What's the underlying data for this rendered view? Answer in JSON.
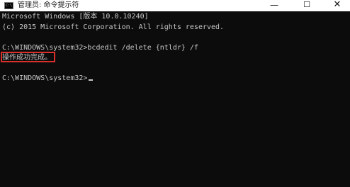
{
  "window": {
    "title": "管理员: 命令提示符",
    "icon": "cmd-icon",
    "icon_label": "C:\\",
    "controls": {
      "minimize": "—",
      "maximize": "☐",
      "close": "✕"
    }
  },
  "console": {
    "lines": [
      "Microsoft Windows [版本 10.0.10240]",
      "(c) 2015 Microsoft Corporation. All rights reserved.",
      "C:\\WINDOWS\\system32>bcdedit /delete {ntldr} /f",
      "操作成功完成。",
      "",
      "C:\\WINDOWS\\system32>"
    ],
    "highlight_color": "#d9302c",
    "text_color": "#c8c8c8",
    "background_color": "#0c0c0c"
  }
}
